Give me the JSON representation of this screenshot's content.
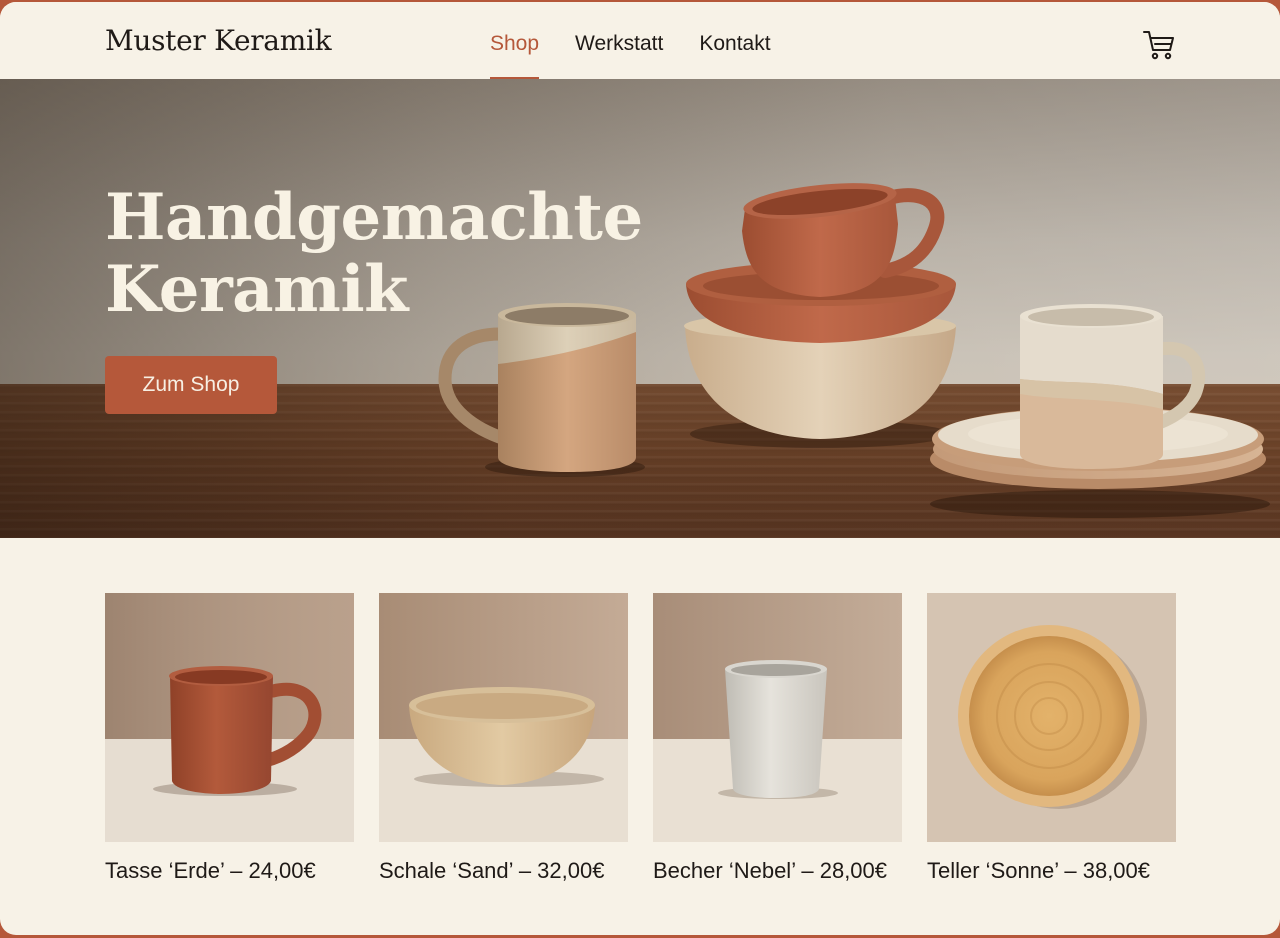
{
  "header": {
    "logo": "Muster Keramik",
    "nav": [
      {
        "label": "Shop",
        "active": true
      },
      {
        "label": "Werkstatt",
        "active": false
      },
      {
        "label": "Kontakt",
        "active": false
      }
    ],
    "cart_icon": "shopping-cart-icon"
  },
  "hero": {
    "title_line1": "Handgemachte",
    "title_line2": "Keramik",
    "cta_label": "Zum Shop"
  },
  "products": [
    {
      "caption": "Tasse ‘Erde’ – 24,00€",
      "item": "terracotta mug"
    },
    {
      "caption": "Schale ‘Sand’ – 32,00€",
      "item": "sand bowl"
    },
    {
      "caption": "Becher ‘Nebel’ – 28,00€",
      "item": "grey cup"
    },
    {
      "caption": "Teller ‘Sonne’ – 38,00€",
      "item": "ochre plate"
    }
  ],
  "colors": {
    "accent": "#b5583a",
    "background": "#f7f2e7",
    "text": "#1f1a17",
    "frame": "#b5583a"
  }
}
